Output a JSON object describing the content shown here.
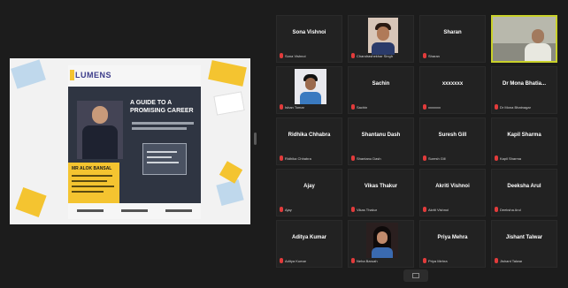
{
  "accent_color": "#c9d12a",
  "mic_muted_color": "#e23b3b",
  "shared_screen": {
    "logo_text": "LUMENS",
    "headline": "A GUIDE TO A PROMISING CAREER",
    "speaker_name": "MR ALOK BANSAL"
  },
  "participants": [
    {
      "display_name": "Sona Vishnoi",
      "label": "Sona Vishnoi",
      "video": false
    },
    {
      "display_name": "",
      "label": "Chandrashekhar Singh",
      "video": true
    },
    {
      "display_name": "Sharan",
      "label": "Sharan",
      "video": false
    },
    {
      "display_name": "",
      "label": "",
      "video": true
    },
    {
      "display_name": "",
      "label": "Ishan Tomar",
      "video": true
    },
    {
      "display_name": "Sachin",
      "label": "Sachin",
      "video": false
    },
    {
      "display_name": "xxxxxxx",
      "label": "xxxxxxx",
      "video": false
    },
    {
      "display_name": "Dr Mona Bhatia...",
      "label": "Dr Mona Bhatnagar",
      "video": false
    },
    {
      "display_name": "Ridhika Chhabra",
      "label": "Ridhika Chhabra",
      "video": false
    },
    {
      "display_name": "Shantanu Dash",
      "label": "Shantanu Dash",
      "video": false
    },
    {
      "display_name": "Suresh Gill",
      "label": "Suresh Gill",
      "video": false
    },
    {
      "display_name": "Kapil Sharma",
      "label": "Kapil Sharma",
      "video": false
    },
    {
      "display_name": "Ajay",
      "label": "Ajay",
      "video": false
    },
    {
      "display_name": "Vikas Thakur",
      "label": "Vikas Thakur",
      "video": false
    },
    {
      "display_name": "Akriti Vishnoi",
      "label": "Akriti Vishnoi",
      "video": false
    },
    {
      "display_name": "Deeksha Arul",
      "label": "Deeksha Arul",
      "video": false
    },
    {
      "display_name": "Aditya Kumar",
      "label": "Aditya Kumar",
      "video": false
    },
    {
      "display_name": "",
      "label": "Neha Baruah",
      "video": true
    },
    {
      "display_name": "Priya Mehra",
      "label": "Priya Mehra",
      "video": false
    },
    {
      "display_name": "Jishant Talwar",
      "label": "Jishant Talwar",
      "video": false
    }
  ]
}
